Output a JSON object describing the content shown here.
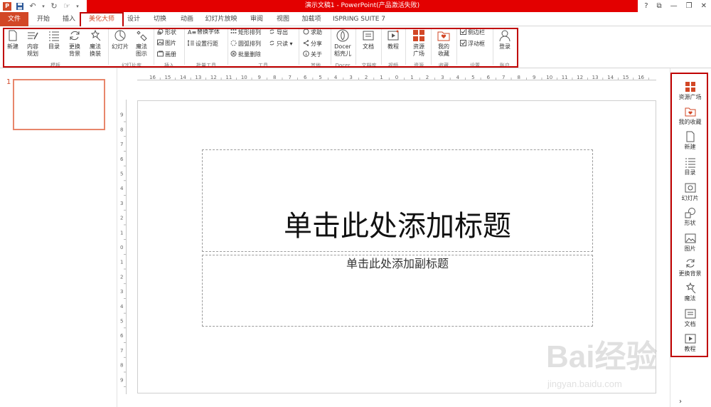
{
  "window": {
    "title": "演示文稿1 - PowerPoint(产品激活失败)",
    "controls": [
      "?",
      "⧉",
      "—",
      "❐",
      "✕"
    ]
  },
  "tabs": [
    {
      "label": "文件"
    },
    {
      "label": "开始"
    },
    {
      "label": "插入"
    },
    {
      "label": "美化大师"
    },
    {
      "label": "设计"
    },
    {
      "label": "切换"
    },
    {
      "label": "动画"
    },
    {
      "label": "幻灯片放映"
    },
    {
      "label": "审阅"
    },
    {
      "label": "视图"
    },
    {
      "label": "加载项"
    },
    {
      "label": "ISPRING SUITE 7"
    }
  ],
  "ribbon": {
    "template": {
      "new": "新建",
      "content_plan_1": "内容",
      "content_plan_2": "规划",
      "toc": "目录",
      "change_bg_1": "更换",
      "change_bg_2": "背景",
      "magic_1": "魔法",
      "magic_2": "换装",
      "group": "模板"
    },
    "slides": {
      "slide": "幻灯片",
      "magic_1": "魔法",
      "magic_2": "图示",
      "group": "幻灯片库"
    },
    "insert": {
      "shape": "形状",
      "picture": "图片",
      "gallery": "画册",
      "group": "插入"
    },
    "batch": {
      "replace_font": "替换字体",
      "line_spacing": "设置行距",
      "group": "批量工具"
    },
    "tools": {
      "rect_arrange": "矩形排列",
      "arc_arrange": "圆弧排列",
      "batch_delete": "批量删除",
      "export": "导出",
      "readonly": "只读",
      "group": "工具"
    },
    "other": {
      "help": "求助",
      "share": "分享",
      "about": "关于",
      "group": "其他"
    },
    "docer": {
      "label_1": "Docer",
      "label_2": "稻壳儿",
      "group": "Docer"
    },
    "doc": {
      "label": "文档",
      "group": "文档库"
    },
    "video": {
      "label": "教程",
      "group": "视频"
    },
    "resource": {
      "label_1": "资源",
      "label_2": "广场",
      "group": "资源"
    },
    "fav": {
      "label_1": "我的",
      "label_2": "收藏",
      "group": "收藏"
    },
    "settings": {
      "sidebar": "侧边栏",
      "floating": "浮动框",
      "group": "设置"
    },
    "account": {
      "login": "登录",
      "group": "账户"
    }
  },
  "thumbnails": [
    {
      "number": "1"
    }
  ],
  "slide": {
    "title_placeholder": "单击此处添加标题",
    "subtitle_placeholder": "单击此处添加副标题"
  },
  "ruler": {
    "h_marks": [
      "16",
      "15",
      "14",
      "13",
      "12",
      "11",
      "10",
      "9",
      "8",
      "7",
      "6",
      "5",
      "4",
      "3",
      "2",
      "1",
      "0",
      "1",
      "2",
      "3",
      "4",
      "5",
      "6",
      "7",
      "8",
      "9",
      "10",
      "11",
      "12",
      "13",
      "14",
      "15",
      "16"
    ],
    "v_marks": [
      "9",
      "8",
      "7",
      "6",
      "5",
      "4",
      "3",
      "2",
      "1",
      "0",
      "1",
      "2",
      "3",
      "4",
      "5",
      "6",
      "7",
      "8",
      "9"
    ]
  },
  "right_panel": {
    "items": [
      {
        "label": "资源广场"
      },
      {
        "label": "我的收藏"
      },
      {
        "label": "新建"
      },
      {
        "label": "目录"
      },
      {
        "label": "幻灯片"
      },
      {
        "label": "形状"
      },
      {
        "label": "图片"
      },
      {
        "label": "更换背景"
      },
      {
        "label": "魔法"
      },
      {
        "label": "文档"
      },
      {
        "label": "教程"
      }
    ],
    "collapse": "›"
  },
  "watermark": {
    "brand": "Bai经验",
    "url": "jingyan.baidu.com"
  },
  "colors": {
    "accent": "#d24726",
    "highlight": "#c00000",
    "titlebar": "#e30000"
  }
}
